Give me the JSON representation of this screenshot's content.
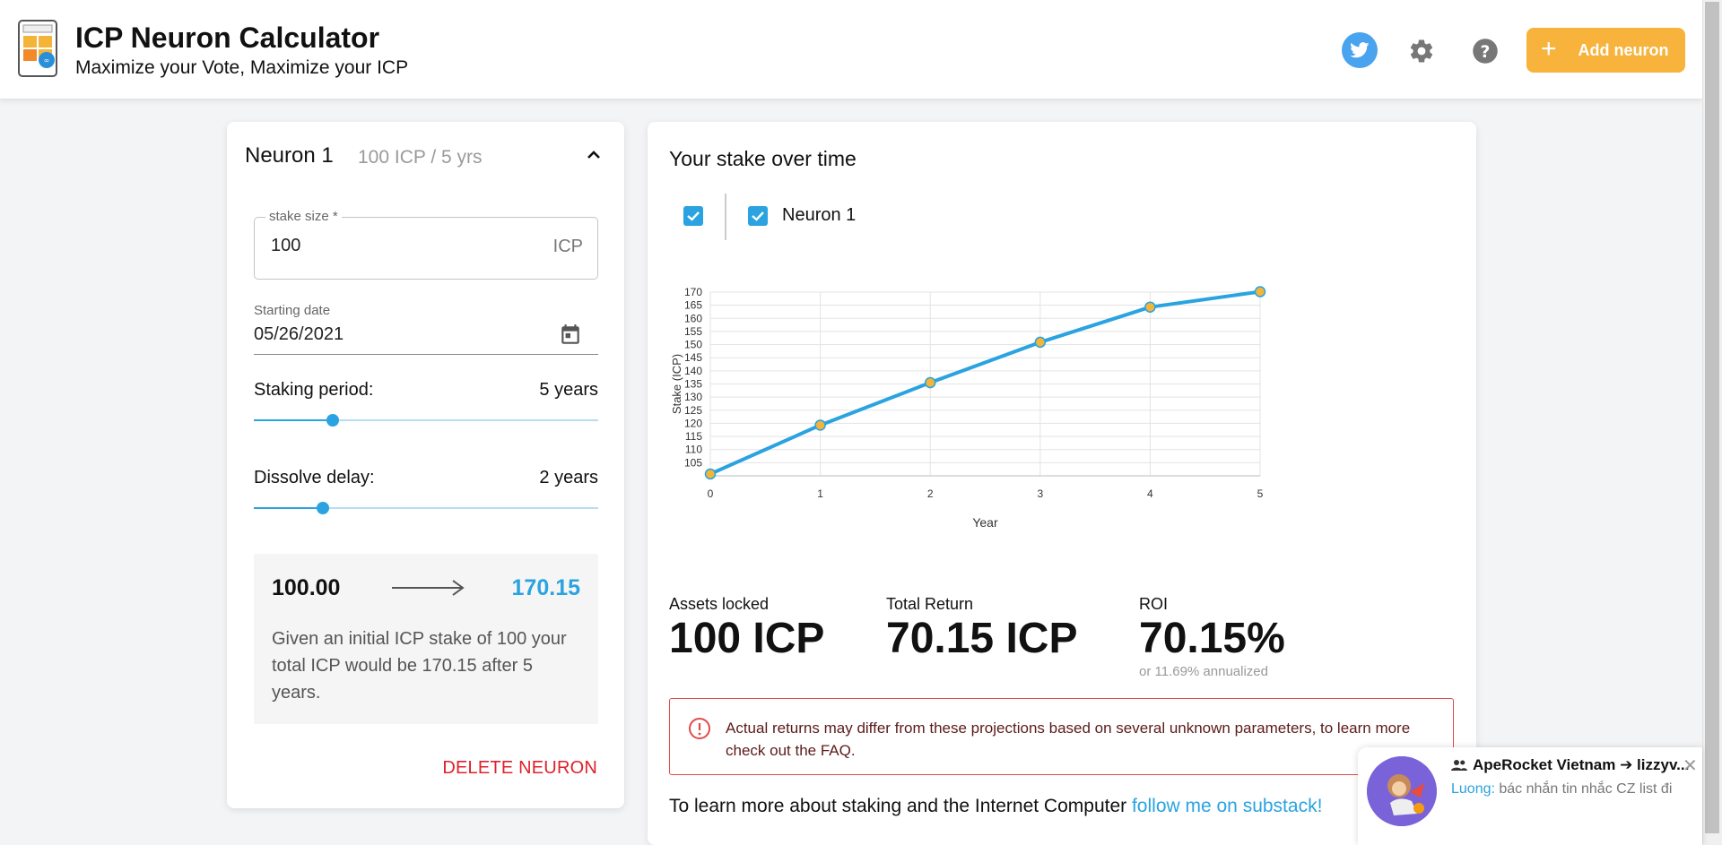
{
  "header": {
    "title": "ICP Neuron Calculator",
    "subtitle": "Maximize your Vote, Maximize your ICP",
    "add_button_label": "Add neuron"
  },
  "neuron": {
    "title": "Neuron 1",
    "summary": "100 ICP / 5 yrs",
    "stake_label": "stake size *",
    "stake_value": "100",
    "stake_unit": "ICP",
    "date_label": "Starting date",
    "date_value": "05/26/2021",
    "period_label": "Staking period:",
    "period_value": "5 years",
    "period_slider_fraction": 0.23,
    "delay_label": "Dissolve delay:",
    "delay_value": "2 years",
    "delay_slider_fraction": 0.2,
    "start_amount": "100.00",
    "end_amount": "170.15",
    "explanation": "Given an initial ICP stake of 100 your total ICP would be 170.15 after 5 years.",
    "delete_label": "DELETE NEURON"
  },
  "chart_section": {
    "heading": "Your stake over time",
    "series_checkbox_label": "Neuron 1"
  },
  "chart_data": {
    "type": "line",
    "xlabel": "Year",
    "ylabel": "Stake (ICP)",
    "x": [
      0,
      1,
      2,
      3,
      4,
      5
    ],
    "series": [
      {
        "name": "Neuron 1",
        "values": [
          100.7,
          119.3,
          135.5,
          150.9,
          164.3,
          170.15
        ]
      }
    ],
    "xlim": [
      0,
      5
    ],
    "ylim": [
      100,
      170
    ],
    "yticks": [
      "105",
      "110",
      "115",
      "120",
      "125",
      "130",
      "135",
      "140",
      "145",
      "150",
      "155",
      "160",
      "165",
      "170"
    ],
    "xticks": [
      "0",
      "1",
      "2",
      "3",
      "4",
      "5"
    ],
    "grid": true,
    "line_color": "#2aa3e0",
    "point_color": "#f2b43a"
  },
  "stats": {
    "assets_label": "Assets locked",
    "assets_value": "100 ICP",
    "return_label": "Total Return",
    "return_value": "70.15 ICP",
    "roi_label": "ROI",
    "roi_value": "70.15%",
    "roi_sub": "or 11.69% annualized"
  },
  "warning": {
    "text": "Actual returns may differ from these projections based on several unknown parameters, to learn more check out the FAQ."
  },
  "learn_more": {
    "text": "To learn more about staking and the Internet Computer ",
    "link": "follow me on substack!"
  },
  "notification": {
    "title": "ApeRocket Vietnam ➔ lizzyv...",
    "sender": "Luong:",
    "message": " bác nhắn tin nhắc CZ list đi",
    "close": "✕"
  }
}
